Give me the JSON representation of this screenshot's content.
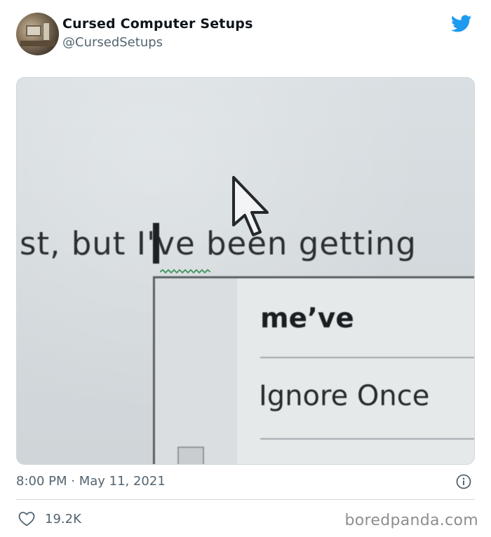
{
  "author": {
    "display_name": "Cursed Computer Setups",
    "handle": "@CursedSetups",
    "avatar_icon": "avatar-photo-computer-setup"
  },
  "brand": {
    "icon": "twitter-bird-icon",
    "color": "#1d9bf0"
  },
  "media": {
    "document_text": "st, but I've been getting",
    "context_menu": {
      "suggestion": "me’ve",
      "ignore_label": "Ignore Once"
    }
  },
  "tweet": {
    "timestamp": "8:00 PM · May 11, 2021",
    "like_count": "19.2K"
  },
  "watermark": "boredpanda.com",
  "colors": {
    "secondary_text": "#536471",
    "divider": "#cfd9de",
    "watermark": "#8e8e8e"
  }
}
